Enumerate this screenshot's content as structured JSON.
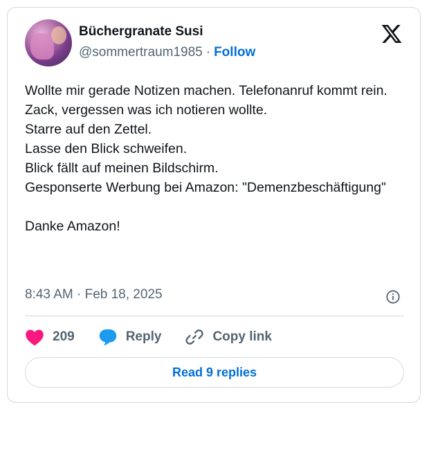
{
  "author": {
    "display_name": "Büchergranate Susi",
    "handle": "@sommertraum1985",
    "separator": "·",
    "follow_label": "Follow"
  },
  "tweet": {
    "text": "Wollte mir gerade Notizen machen. Telefonanruf kommt rein.\nZack, vergessen was ich notieren wollte.\nStarre auf den Zettel.\nLasse den Blick schweifen.\nBlick fällt auf meinen Bildschirm.\nGesponserte Werbung bei Amazon: \"Demenzbeschäftigung\"\n\nDanke Amazon!",
    "timestamp": "8:43 AM · Feb 18, 2025"
  },
  "actions": {
    "like_count": "209",
    "reply_label": "Reply",
    "copy_label": "Copy link"
  },
  "read_replies_label": "Read 9 replies",
  "icons": {
    "brand": "x-logo-icon",
    "info": "info-icon",
    "like": "heart-icon",
    "reply": "speech-bubble-icon",
    "copy": "link-icon"
  },
  "colors": {
    "heart": "#f91880",
    "reply_bubble": "#1d9bf0",
    "link_blue": "#006fd6",
    "muted_text": "#536471",
    "border": "#cfd9de"
  }
}
